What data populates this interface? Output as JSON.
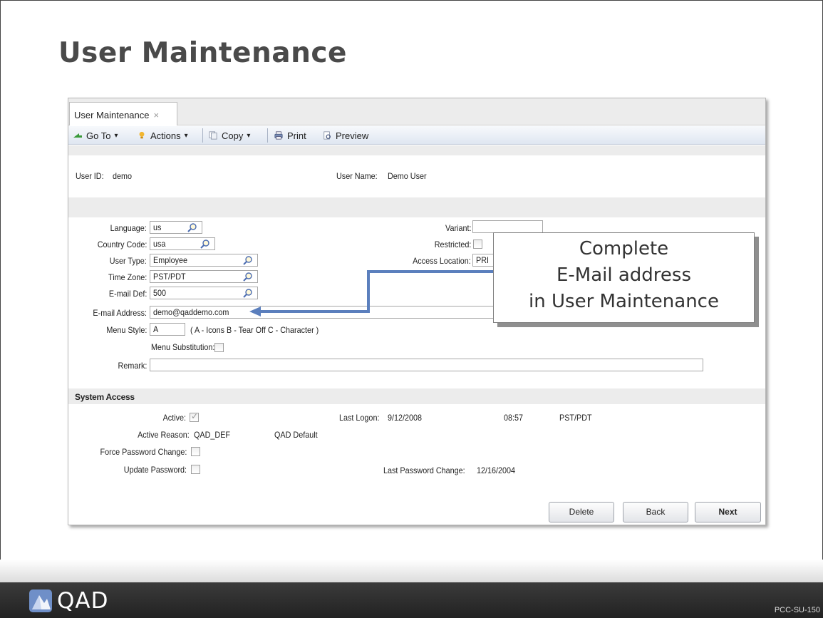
{
  "slide": {
    "title": "User Maintenance",
    "code": "PCC-SU-150",
    "logo_text": "QAD"
  },
  "tab": {
    "label": "User Maintenance",
    "close_glyph": "×"
  },
  "toolbar": {
    "goto": "Go To",
    "actions": "Actions",
    "copy": "Copy",
    "print": "Print",
    "preview": "Preview",
    "dropdown_glyph": "▾"
  },
  "header": {
    "user_id_label": "User ID:",
    "user_id": "demo",
    "user_name_label": "User Name:",
    "user_name": "Demo User"
  },
  "form": {
    "language_label": "Language:",
    "language": "us",
    "country_label": "Country Code:",
    "country": "usa",
    "user_type_label": "User Type:",
    "user_type": "Employee",
    "time_zone_label": "Time Zone:",
    "time_zone": "PST/PDT",
    "email_def_label": "E-mail Def:",
    "email_def": "500",
    "email_label": "E-mail Address:",
    "email": "demo@qaddemo.com",
    "menu_style_label": "Menu Style:",
    "menu_style": "A",
    "menu_style_hint": "( A - Icons  B - Tear Off  C - Character )",
    "menu_sub_label": "Menu Substitution:",
    "remark_label": "Remark:",
    "remark": "",
    "variant_label": "Variant:",
    "variant": "",
    "restricted_label": "Restricted:",
    "access_location_label": "Access Location:",
    "access_location": "PRI"
  },
  "system_access": {
    "title": "System Access",
    "active_label": "Active:",
    "active": true,
    "last_logon_label": "Last Logon:",
    "last_logon_date": "9/12/2008",
    "last_logon_time": "08:57",
    "last_logon_tz": "PST/PDT",
    "active_reason_label": "Active Reason:",
    "active_reason": "QAD_DEF",
    "active_reason_desc": "QAD Default",
    "force_pw_label": "Force Password Change:",
    "update_pw_label": "Update Password:",
    "last_pw_change_label": "Last Password Change:",
    "last_pw_change": "12/16/2004"
  },
  "buttons": {
    "delete": "Delete",
    "back": "Back",
    "next": "Next"
  },
  "callout": {
    "line1": "Complete",
    "line2": "E-Mail address",
    "line3": "in User Maintenance"
  },
  "colors": {
    "arrow": "#5b7fbd",
    "footer": "#2b2b2b",
    "title": "#4a4a4a"
  }
}
